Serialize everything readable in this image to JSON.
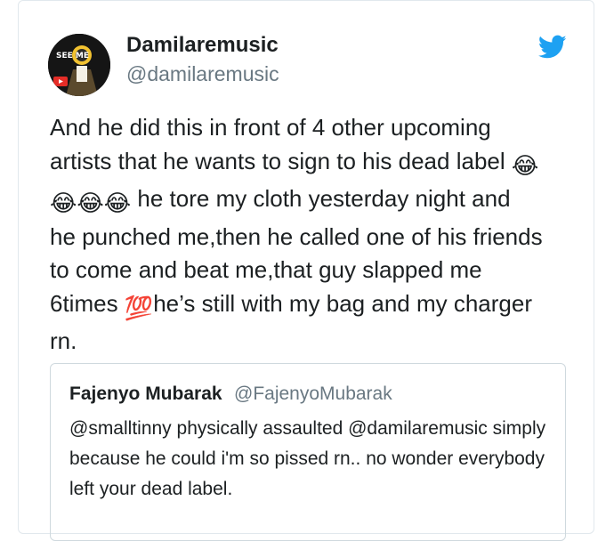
{
  "tweet": {
    "display_name": "Damilaremusic",
    "handle": "@damilaremusic",
    "avatar_text": "SEE ME",
    "bird_icon": "twitter-bird-icon",
    "text_segments": [
      "And he did this in front of 4 other upcoming",
      "artists that he wants to sign to his dead label",
      "he tore my cloth yesterday night and",
      "he punched me,then he called one of his friends",
      "to come and beat me,that guy slapped me",
      "6times",
      "he’s still with my bag and my charger",
      "rn."
    ],
    "emoji_laugh": "😂",
    "emoji_100": "💯"
  },
  "quote": {
    "display_name": "Fajenyo Mubarak",
    "handle": "@FajenyoMubarak",
    "text": "@smalltinny physically assaulted @damilaremusic simply because he could i'm so pissed rn.. no wonder everybody left your dead label."
  },
  "colors": {
    "twitter_blue": "#1da1f2",
    "border": "#e1e8ed",
    "secondary_text": "#697882",
    "hundred_red": "#e0245e"
  }
}
